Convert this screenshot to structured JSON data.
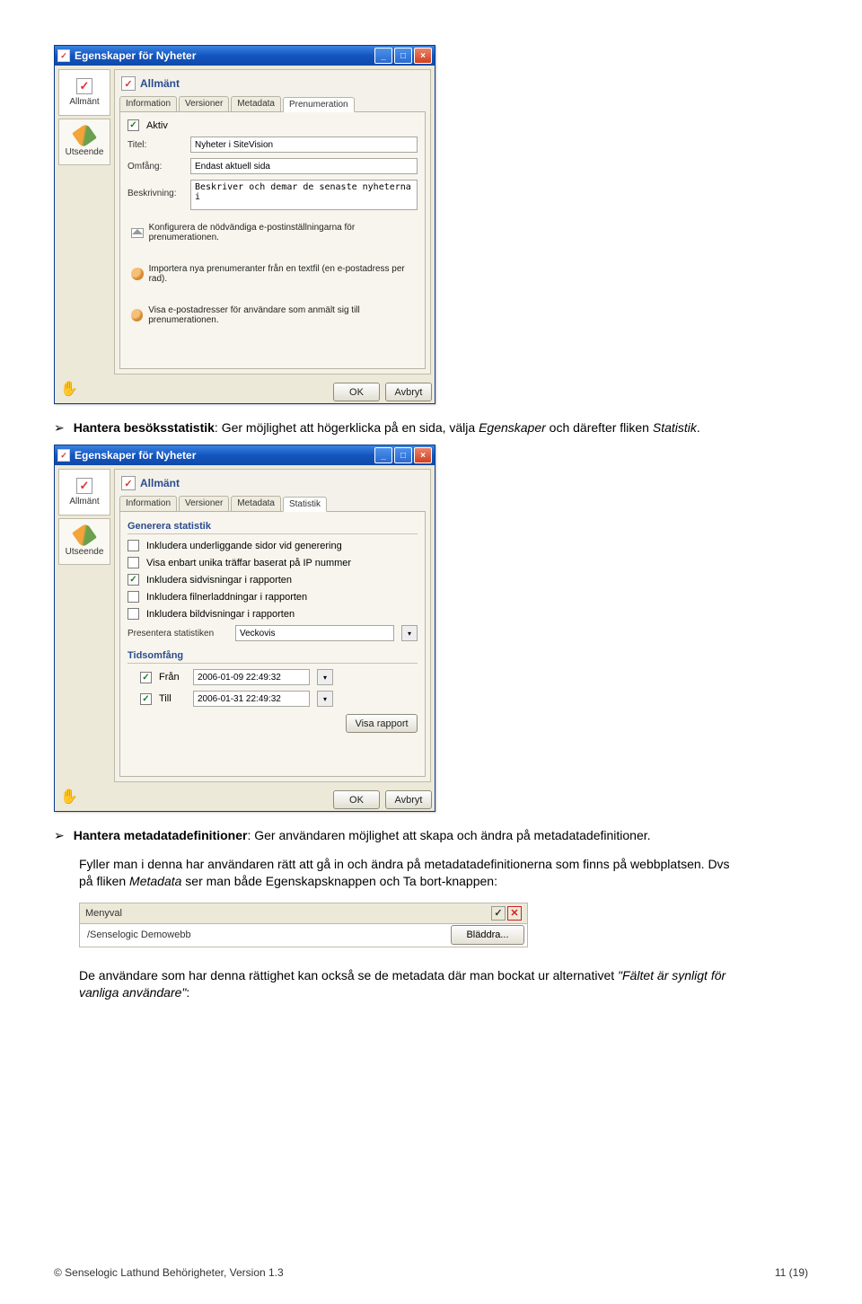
{
  "window1": {
    "title": "Egenskaper för Nyheter",
    "sidenav": {
      "item1": "Allmänt",
      "item2": "Utseende"
    },
    "section_title": "Allmänt",
    "tabs": {
      "t1": "Information",
      "t2": "Versioner",
      "t3": "Metadata",
      "t4": "Prenumeration"
    },
    "form": {
      "aktiv_label": "Aktiv",
      "aktiv_checked": "✓",
      "titel_label": "Titel:",
      "titel_value": "Nyheter i SiteVision",
      "omfang_label": "Omfång:",
      "omfang_value": "Endast aktuell sida",
      "beskrivning_label": "Beskrivning:",
      "beskrivning_value": "Beskriver och demar de senaste nyheterna i"
    },
    "link1": "Konfigurera de nödvändiga e-postinställningarna för prenumerationen.",
    "link2": "Importera nya prenumeranter från en textfil (en e-postadress per rad).",
    "link3": "Visa e-postadresser för användare som anmält sig till prenumerationen.",
    "buttons": {
      "ok": "OK",
      "cancel": "Avbryt"
    }
  },
  "para1": {
    "title": "Hantera besöksstatistik",
    "text": ": Ger möjlighet att högerklicka på en sida, välja ",
    "em1": "Egenskaper",
    "text2": " och därefter fliken ",
    "em2": "Statistik",
    "text3": "."
  },
  "window2": {
    "title": "Egenskaper för Nyheter",
    "sidenav": {
      "item1": "Allmänt",
      "item2": "Utseende"
    },
    "section_title": "Allmänt",
    "tabs": {
      "t1": "Information",
      "t2": "Versioner",
      "t3": "Metadata",
      "t4": "Statistik"
    },
    "fieldset1": "Generera statistik",
    "chk1": "Inkludera underliggande sidor vid generering",
    "chk2": "Visa enbart unika träffar baserat på IP nummer",
    "chk3": "Inkludera sidvisningar i rapporten",
    "chk3_checked": "✓",
    "chk4": "Inkludera filnerladdningar i rapporten",
    "chk5": "Inkludera bildvisningar i rapporten",
    "present_label": "Presentera statistiken",
    "present_value": "Veckovis",
    "fieldset2": "Tidsomfång",
    "from_label": "Från",
    "from_value": "2006-01-09 22:49:32",
    "to_label": "Till",
    "to_value": "2006-01-31 22:49:32",
    "report_btn": "Visa rapport",
    "buttons": {
      "ok": "OK",
      "cancel": "Avbryt"
    }
  },
  "para2": {
    "title": "Hantera metadatadefinitioner",
    "text": ": Ger användaren möjlighet att skapa och ändra på metadatadefinitioner."
  },
  "para3_a": "Fyller man i denna har användaren rätt att gå in och ändra på metadatadefinitionerna som finns på webbplatsen. Dvs på fliken ",
  "para3_em": "Metadata",
  "para3_b": " ser man både Egenskapsknappen och Ta bort-knappen:",
  "menyval": {
    "header": "Menyval",
    "path": "/Senselogic Demowebb",
    "browse": "Bläddra..."
  },
  "para4_a": "De användare som har denna rättighet kan också se de metadata där man bockat ur alternativet ",
  "para4_em": "\"Fältet är synligt för vanliga användare\"",
  "para4_b": ":",
  "footer": {
    "left": "© Senselogic Lathund Behörigheter, Version 1.3",
    "right": "11 (19)"
  }
}
